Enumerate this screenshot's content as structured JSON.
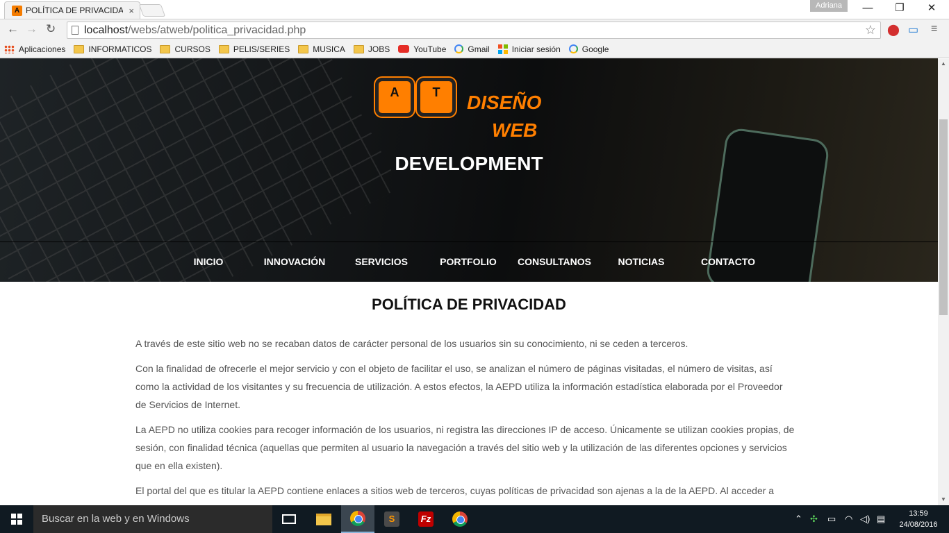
{
  "browser": {
    "tab_title": "POLÍTICA DE PRIVACIDAD",
    "tab_favicon_letter": "A",
    "tab_close": "×",
    "user_name": "Adriana",
    "url_host": "localhost",
    "url_path": "/webs/atweb/politica_privacidad.php",
    "controls": {
      "minimize": "—",
      "restore": "❐",
      "close": "✕"
    }
  },
  "bookmarks": [
    {
      "label": "Aplicaciones",
      "icon": "apps-icon"
    },
    {
      "label": "INFORMATICOS",
      "icon": "folder-icon"
    },
    {
      "label": "CURSOS",
      "icon": "folder-icon"
    },
    {
      "label": "PELIS/SERIES",
      "icon": "folder-icon"
    },
    {
      "label": "MUSICA",
      "icon": "folder-icon"
    },
    {
      "label": "JOBS",
      "icon": "folder-icon"
    },
    {
      "label": "YouTube",
      "icon": "youtube-icon"
    },
    {
      "label": "Gmail",
      "icon": "google-icon"
    },
    {
      "label": "Iniciar sesión",
      "icon": "microsoft-icon"
    },
    {
      "label": "Google",
      "icon": "google-icon"
    }
  ],
  "site": {
    "logo_key_1": "A",
    "logo_key_2": "T",
    "logo_text_1": "DISEÑO",
    "logo_text_2": "WEB",
    "subtitle": "DEVELOPMENT",
    "nav": [
      "INICIO",
      "INNOVACIÓN",
      "SERVICIOS",
      "PORTFOLIO",
      "CONSULTANOS",
      "NOTICIAS",
      "CONTACTO"
    ],
    "page_title": "POLÍTICA DE PRIVACIDAD",
    "paragraphs": [
      "A través de este sitio web no se recaban datos de carácter personal de los usuarios sin su conocimiento, ni se ceden a terceros.",
      "Con la finalidad de ofrecerle el mejor servicio y con el objeto de facilitar el uso, se analizan el número de páginas visitadas, el número de visitas, así como la actividad de los visitantes y su frecuencia de utilización. A estos efectos, la AEPD utiliza la información estadística elaborada por el Proveedor de Servicios de Internet.",
      "La AEPD no utiliza cookies para recoger información de los usuarios, ni registra las direcciones IP de acceso. Únicamente se utilizan cookies propias, de sesión, con finalidad técnica (aquellas que permiten al usuario la navegación a través del sitio web y la utilización de las diferentes opciones y servicios que en ella existen).",
      "El portal del que es titular la AEPD contiene enlaces a sitios web de terceros, cuyas políticas de privacidad son ajenas a la de la AEPD. Al acceder a"
    ]
  },
  "taskbar": {
    "search_placeholder": "Buscar en la web y en Windows",
    "time": "13:59",
    "date": "24/08/2016"
  }
}
